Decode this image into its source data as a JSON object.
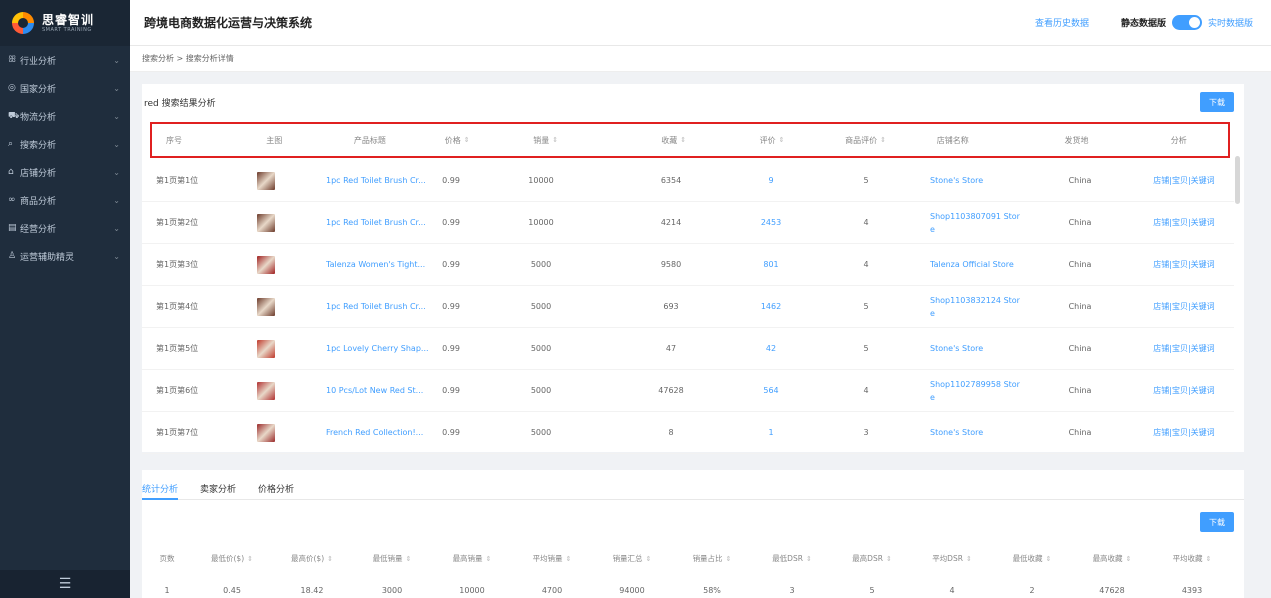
{
  "app": {
    "logo_cn": "思睿智训",
    "logo_en": "SMART TRAINING",
    "title": "跨境电商数据化运营与决策系统",
    "history_link": "查看历史数据",
    "mode_static": "静态数据版",
    "mode_live": "实时数据版"
  },
  "sidebar": {
    "items": [
      {
        "icon": "ꕥ",
        "label": "行业分析"
      },
      {
        "icon": "◎",
        "label": "国家分析"
      },
      {
        "icon": "⛟",
        "label": "物流分析"
      },
      {
        "icon": "⌕",
        "label": "搜索分析"
      },
      {
        "icon": "⌂",
        "label": "店铺分析"
      },
      {
        "icon": "∞",
        "label": "商品分析"
      },
      {
        "icon": "▤",
        "label": "经营分析"
      },
      {
        "icon": "♙",
        "label": "运营辅助精灵"
      }
    ],
    "footer_icon": "☰"
  },
  "breadcrumb": "搜索分析 > 搜索分析详情",
  "search": {
    "title": "red 搜索结果分析",
    "download": "下载",
    "headers": [
      "序号",
      "主图",
      "产品标题",
      "价格",
      "销量",
      "收藏",
      "评价",
      "商品评价",
      "店铺名称",
      "发货地",
      "分析"
    ],
    "rows": [
      {
        "rank": "第1页第1位",
        "title": "1pc Red Toilet Brush Cr...",
        "price": "0.99",
        "sales": "10000",
        "fav": "6354",
        "reviews": "9",
        "rating": "5",
        "shop": "Stone's Store",
        "ship": "China",
        "ops": "店铺|宝贝|关键词",
        "color": "#6b3a2a"
      },
      {
        "rank": "第1页第2位",
        "title": "1pc Red Toilet Brush Cr...",
        "price": "0.99",
        "sales": "10000",
        "fav": "4214",
        "reviews": "2453",
        "rating": "4",
        "shop": "Shop1103807091 Store",
        "ship": "China",
        "ops": "店铺|宝贝|关键词",
        "color": "#6b3a2a"
      },
      {
        "rank": "第1页第3位",
        "title": "Talenza Women's Tight...",
        "price": "0.99",
        "sales": "5000",
        "fav": "9580",
        "reviews": "801",
        "rating": "4",
        "shop": "Talenza Official Store",
        "ship": "China",
        "ops": "店铺|宝贝|关键词",
        "color": "#a02020"
      },
      {
        "rank": "第1页第4位",
        "title": "1pc Red Toilet Brush Cr...",
        "price": "0.99",
        "sales": "5000",
        "fav": "693",
        "reviews": "1462",
        "rating": "5",
        "shop": "Shop1103832124 Store",
        "ship": "China",
        "ops": "店铺|宝贝|关键词",
        "color": "#6b3a2a"
      },
      {
        "rank": "第1页第5位",
        "title": "1pc Lovely Cherry Shap...",
        "price": "0.99",
        "sales": "5000",
        "fav": "47",
        "reviews": "42",
        "rating": "5",
        "shop": "Stone's Store",
        "ship": "China",
        "ops": "店铺|宝贝|关键词",
        "color": "#c0392b"
      },
      {
        "rank": "第1页第6位",
        "title": "10 Pcs/Lot New Red St...",
        "price": "0.99",
        "sales": "5000",
        "fav": "47628",
        "reviews": "564",
        "rating": "4",
        "shop": "Shop1102789958 Store",
        "ship": "China",
        "ops": "店铺|宝贝|关键词",
        "color": "#b03030"
      },
      {
        "rank": "第1页第7位",
        "title": "French Red Collection!...",
        "price": "0.99",
        "sales": "5000",
        "fav": "8",
        "reviews": "1",
        "rating": "3",
        "shop": "Stone's Store",
        "ship": "China",
        "ops": "店铺|宝贝|关键词",
        "color": "#9a2a2a"
      }
    ]
  },
  "stats": {
    "tabs": [
      "统计分析",
      "卖家分析",
      "价格分析"
    ],
    "download": "下载",
    "headers": [
      "页数",
      "最低价($)",
      "最高价($)",
      "最低销量",
      "最高销量",
      "平均销量",
      "销量汇总",
      "销量占比",
      "最低DSR",
      "最高DSR",
      "平均DSR",
      "最低收藏",
      "最高收藏",
      "平均收藏"
    ],
    "row": [
      "1",
      "0.45",
      "18.42",
      "3000",
      "10000",
      "4700",
      "94000",
      "58%",
      "3",
      "5",
      "4",
      "2",
      "47628",
      "4393"
    ]
  }
}
